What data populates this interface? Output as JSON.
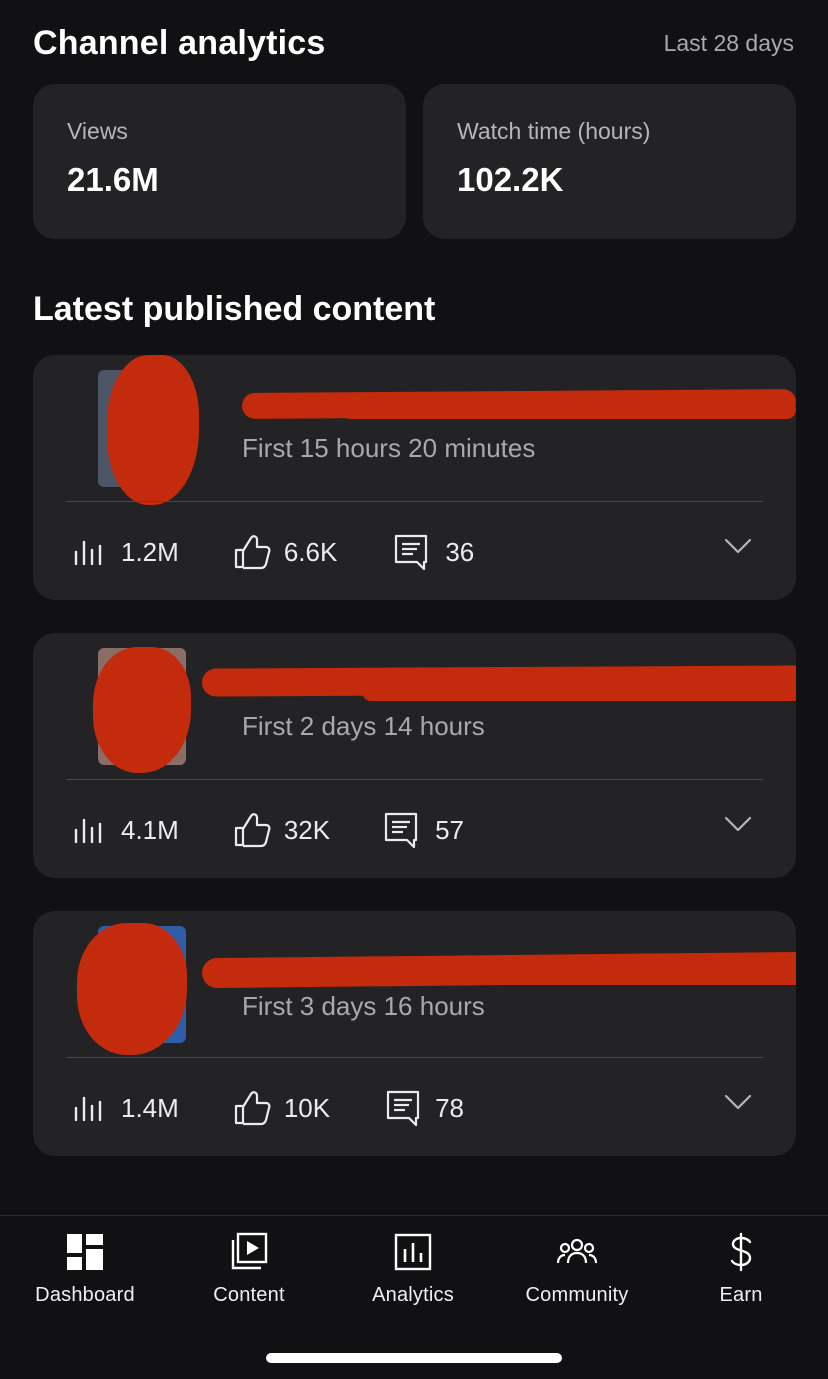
{
  "header": {
    "title": "Channel analytics",
    "range": "Last 28 days"
  },
  "stats": [
    {
      "label": "Views",
      "value": "21.6M"
    },
    {
      "label": "Watch time (hours)",
      "value": "102.2K"
    }
  ],
  "latest": {
    "title": "Latest published content",
    "items": [
      {
        "subtitle": "First 15 hours 20 minutes",
        "views": "1.2M",
        "likes": "6.6K",
        "comments": "36"
      },
      {
        "subtitle": "First 2 days 14 hours",
        "views": "4.1M",
        "likes": "32K",
        "comments": "57"
      },
      {
        "subtitle": "First 3 days 16 hours",
        "views": "1.4M",
        "likes": "10K",
        "comments": "78"
      }
    ]
  },
  "nav": {
    "items": [
      {
        "label": "Dashboard",
        "icon": "dashboard-icon"
      },
      {
        "label": "Content",
        "icon": "content-icon"
      },
      {
        "label": "Analytics",
        "icon": "analytics-icon"
      },
      {
        "label": "Community",
        "icon": "community-icon"
      },
      {
        "label": "Earn",
        "icon": "dollar-icon"
      }
    ]
  },
  "colors": {
    "background": "#111012",
    "card": "#232225",
    "redaction": "#c42a0c",
    "muted_text": "#a8a8ad"
  }
}
